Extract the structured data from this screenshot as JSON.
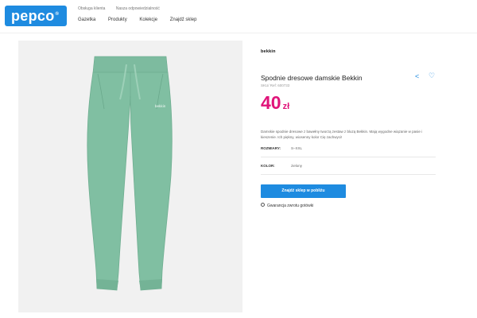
{
  "header": {
    "logo": "pepco",
    "utility": [
      "Obsługa klienta",
      "Nasza odpowiedzialność"
    ],
    "nav": [
      "Gazetka",
      "Produkty",
      "Kolekcje",
      "Znajdź sklep"
    ]
  },
  "product": {
    "brand": "bekkin",
    "title": "Spodnie dresowe damskie Bekkin",
    "sku": "SKU/ Ref: 600733",
    "price": "40",
    "currency": "zł",
    "description": "Damskie spodnie dresowe z bawełny tworzą zestaw z bluzą Bekkin. Mają wygodne wiązanie w pasie i kieszenie. Ich piękny, wiosenny kolor Cię zachwyci!",
    "attributes": [
      {
        "label": "ROZMIARY:",
        "value": "S–XXL"
      },
      {
        "label": "KOLOR:",
        "value": "zielony"
      }
    ],
    "cta": "Znajdź sklep w pobliżu",
    "guarantee": "Gwarancja zwrotu gotówki"
  },
  "colors": {
    "brand_blue": "#1e8be0",
    "price_pink": "#e0147a",
    "pants_green": "#80bfa2"
  },
  "icons": [
    "share-icon",
    "heart-icon",
    "radio-icon"
  ]
}
